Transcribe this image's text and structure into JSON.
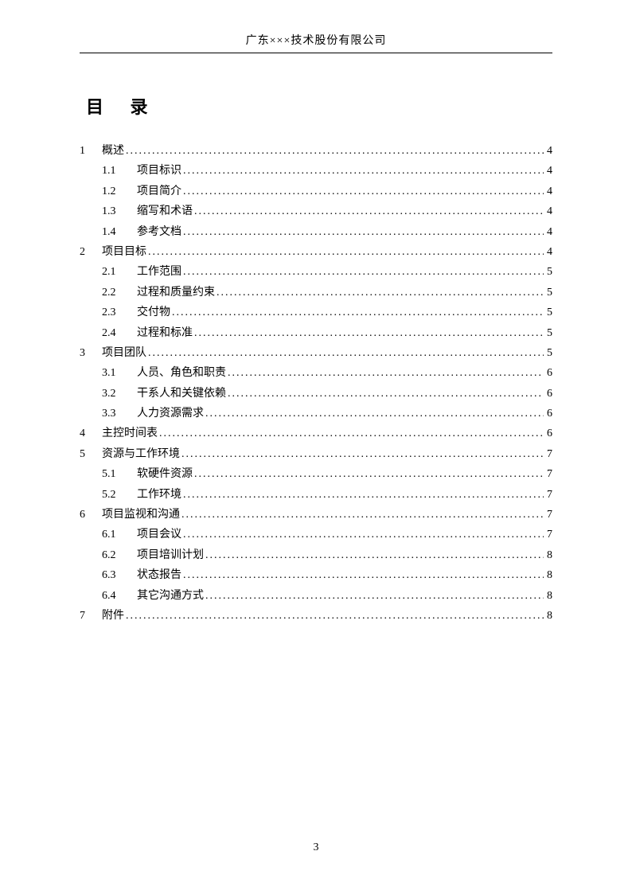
{
  "header": {
    "company": "广东×××技术股份有限公司"
  },
  "title": "目 录",
  "footer": {
    "page_number": "3"
  },
  "toc": [
    {
      "level": 1,
      "num": "1",
      "label": "概述",
      "page": "4"
    },
    {
      "level": 2,
      "num": "1.1",
      "label": "项目标识",
      "page": "4"
    },
    {
      "level": 2,
      "num": "1.2",
      "label": "项目简介",
      "page": "4"
    },
    {
      "level": 2,
      "num": "1.3",
      "label": "缩写和术语",
      "page": "4"
    },
    {
      "level": 2,
      "num": "1.4",
      "label": "参考文档",
      "page": "4"
    },
    {
      "level": 1,
      "num": "2",
      "label": "项目目标",
      "page": "4"
    },
    {
      "level": 2,
      "num": "2.1",
      "label": "工作范围",
      "page": "5"
    },
    {
      "level": 2,
      "num": "2.2",
      "label": "过程和质量约束",
      "page": "5"
    },
    {
      "level": 2,
      "num": "2.3",
      "label": "交付物",
      "page": "5"
    },
    {
      "level": 2,
      "num": "2.4",
      "label": "过程和标准",
      "page": "5"
    },
    {
      "level": 1,
      "num": "3",
      "label": "项目团队",
      "page": "5"
    },
    {
      "level": 2,
      "num": "3.1",
      "label": "人员、角色和职责",
      "page": "6"
    },
    {
      "level": 2,
      "num": "3.2",
      "label": "干系人和关键依赖",
      "page": "6"
    },
    {
      "level": 2,
      "num": "3.3",
      "label": "人力资源需求",
      "page": "6"
    },
    {
      "level": 1,
      "num": "4",
      "label": "主控时间表",
      "page": "6"
    },
    {
      "level": 1,
      "num": "5",
      "label": "资源与工作环境",
      "page": "7"
    },
    {
      "level": 2,
      "num": "5.1",
      "label": "软硬件资源",
      "page": "7"
    },
    {
      "level": 2,
      "num": "5.2",
      "label": "工作环境",
      "page": "7"
    },
    {
      "level": 1,
      "num": "6",
      "label": "项目监视和沟通",
      "page": "7"
    },
    {
      "level": 2,
      "num": "6.1",
      "label": "项目会议",
      "page": "7"
    },
    {
      "level": 2,
      "num": "6.2",
      "label": "项目培训计划",
      "page": "8"
    },
    {
      "level": 2,
      "num": "6.3",
      "label": "状态报告",
      "page": "8"
    },
    {
      "level": 2,
      "num": "6.4",
      "label": "其它沟通方式",
      "page": "8"
    },
    {
      "level": 1,
      "num": "7",
      "label": "附件",
      "page": "8"
    }
  ]
}
